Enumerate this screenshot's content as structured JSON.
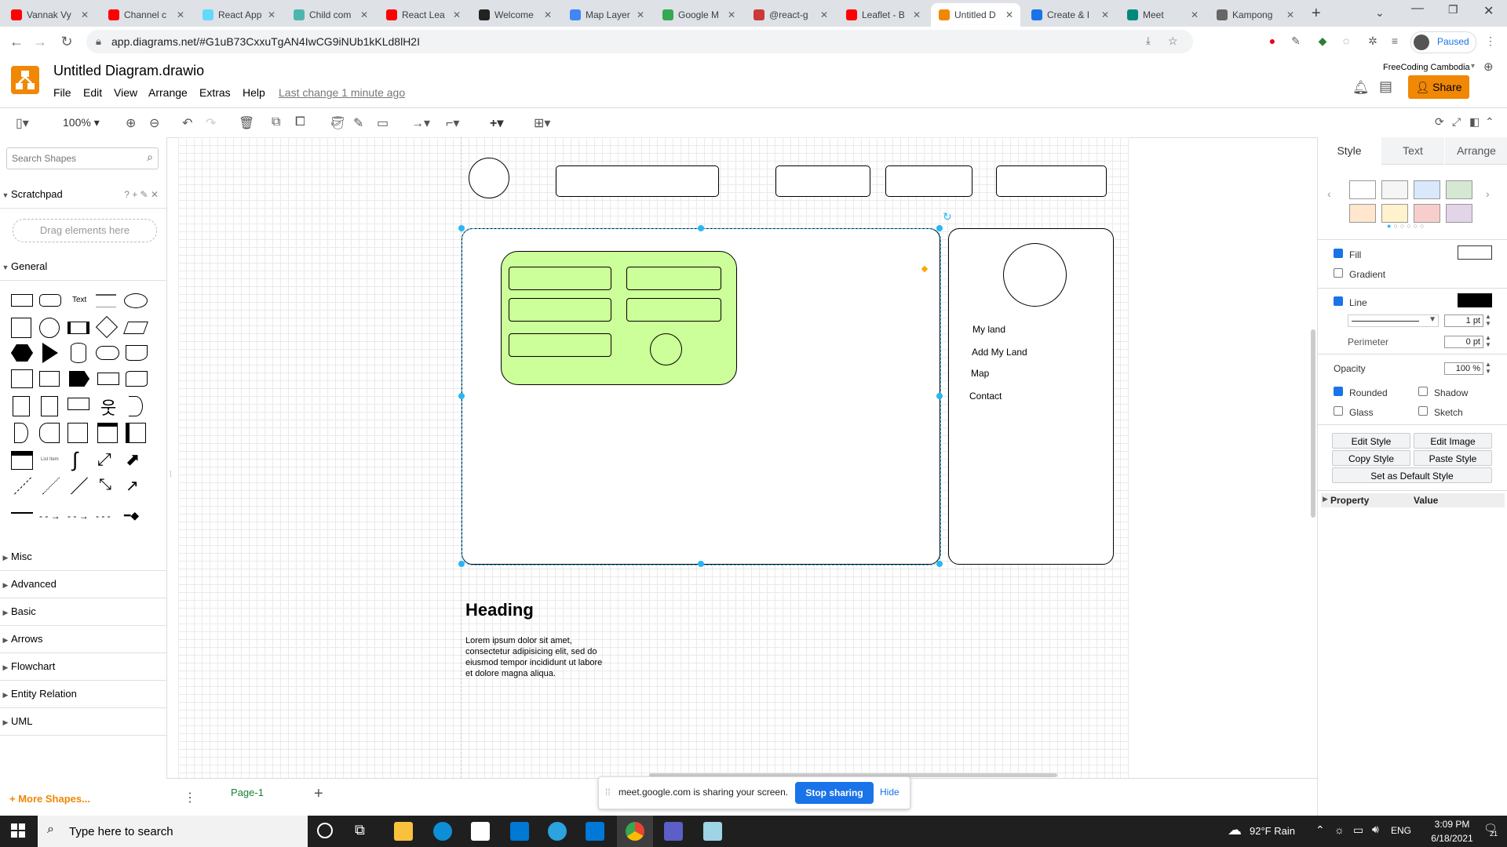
{
  "browser": {
    "tabs": [
      {
        "label": "Vannak Vy",
        "color": "#ff0000"
      },
      {
        "label": "Channel c",
        "color": "#ff0000"
      },
      {
        "label": "React App",
        "color": "#61dafb"
      },
      {
        "label": "Child com",
        "color": "#4db6ac"
      },
      {
        "label": "React Lea",
        "color": "#ff0000"
      },
      {
        "label": "Welcome",
        "color": "#222222"
      },
      {
        "label": "Map Layer",
        "color": "#4285f4"
      },
      {
        "label": "Google M",
        "color": "#34a853"
      },
      {
        "label": "@react-g",
        "color": "#cb3837"
      },
      {
        "label": "Leaflet - B",
        "color": "#ff0000"
      },
      {
        "label": "Untitled D",
        "color": "#f08705"
      },
      {
        "label": "Create & I",
        "color": "#1a73e8"
      },
      {
        "label": "Meet",
        "color": "#00897b"
      },
      {
        "label": "Kampong",
        "color": "#666666"
      }
    ],
    "url": "app.diagrams.net/#G1uB73CxxuTgAN4IwCG9iNUb1kKLd8lH2I",
    "profile_status": "Paused"
  },
  "app": {
    "title": "Untitled Diagram.drawio",
    "menu": [
      "File",
      "Edit",
      "View",
      "Arrange",
      "Extras",
      "Help"
    ],
    "last_change": "Last change 1 minute ago",
    "account": "FreeCoding Cambodia",
    "share_label": "Share"
  },
  "toolbar": {
    "zoom": "100%"
  },
  "sidebar": {
    "search_placeholder": "Search Shapes",
    "scratchpad": "Scratchpad",
    "drag_hint": "Drag elements here",
    "general": "General",
    "text_shape": "Text",
    "sections": [
      "Misc",
      "Advanced",
      "Basic",
      "Arrows",
      "Flowchart",
      "Entity Relation",
      "UML"
    ],
    "more_shapes": "More Shapes..."
  },
  "canvas": {
    "menu_items": [
      "My land",
      "Add My Land",
      "Map",
      "Contact"
    ],
    "heading": "Heading",
    "paragraph": "Lorem ipsum dolor sit amet, consectetur adipisicing elit, sed do eiusmod tempor incididunt ut labore et dolore magna aliqua.",
    "card_fill": "#ccff99"
  },
  "format_panel": {
    "tabs": [
      "Style",
      "Text",
      "Arrange"
    ],
    "swatches": [
      "#ffffff",
      "#f5f5f5",
      "#dae8fc",
      "#d5e8d4",
      "#ffe6cc",
      "#fff2cc",
      "#f8cecc",
      "#e1d5e7"
    ],
    "fill": "Fill",
    "gradient": "Gradient",
    "line": "Line",
    "line_width": "1 pt",
    "perimeter": "Perimeter",
    "perimeter_value": "0 pt",
    "opacity": "Opacity",
    "opacity_value": "100 %",
    "rounded": "Rounded",
    "shadow": "Shadow",
    "glass": "Glass",
    "sketch": "Sketch",
    "edit_style": "Edit Style",
    "edit_image": "Edit Image",
    "copy_style": "Copy Style",
    "paste_style": "Paste Style",
    "set_default": "Set as Default Style",
    "property": "Property",
    "value": "Value"
  },
  "pages": {
    "current": "Page-1"
  },
  "share_banner": {
    "text": "meet.google.com is sharing your screen.",
    "stop": "Stop sharing",
    "hide": "Hide"
  },
  "taskbar": {
    "search_placeholder": "Type here to search",
    "weather": "92°F  Rain",
    "lang": "ENG",
    "time": "3:09 PM",
    "date": "6/18/2021",
    "notif_count": "21"
  }
}
